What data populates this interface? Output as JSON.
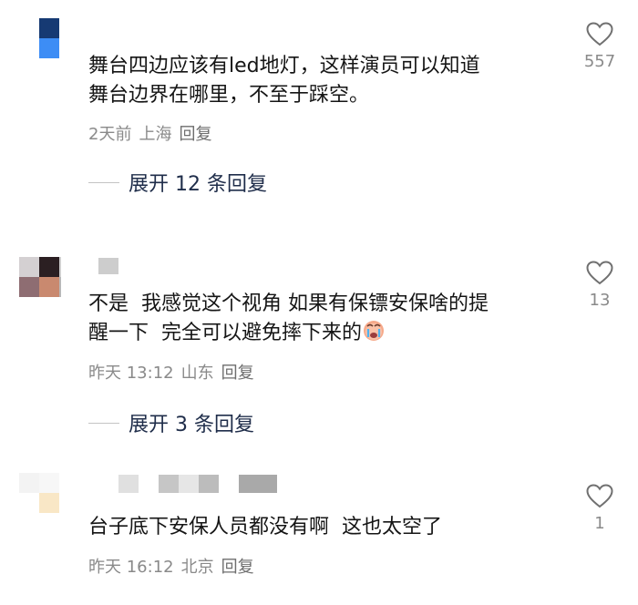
{
  "comments": [
    {
      "text_line1": "舞台四边应该有led地灯，这样演员可以知道",
      "text_line2": "舞台边界在哪里，不至于踩空。",
      "time": "2天前",
      "location": "上海",
      "reply_label": "回复",
      "likes": "557",
      "expand_label": "展开 12 条回复"
    },
    {
      "text_line1": "不是  我感觉这个视角 如果有保镖安保啥的提",
      "text_line2": "醒一下  完全可以避免摔下来的",
      "emoji": "crying-face-emoji",
      "time": "昨天 13:12",
      "location": "山东",
      "reply_label": "回复",
      "likes": "13",
      "expand_label": "展开 3 条回复"
    },
    {
      "text_line1": "台子底下安保人员都没有啊  这也太空了",
      "time": "昨天 16:12",
      "location": "北京",
      "reply_label": "回复",
      "likes": "1"
    }
  ],
  "icons": {
    "like": "heart-outline-icon"
  },
  "colors": {
    "accent_text": "#1f2d4a",
    "meta_text": "#8a8a8a"
  }
}
